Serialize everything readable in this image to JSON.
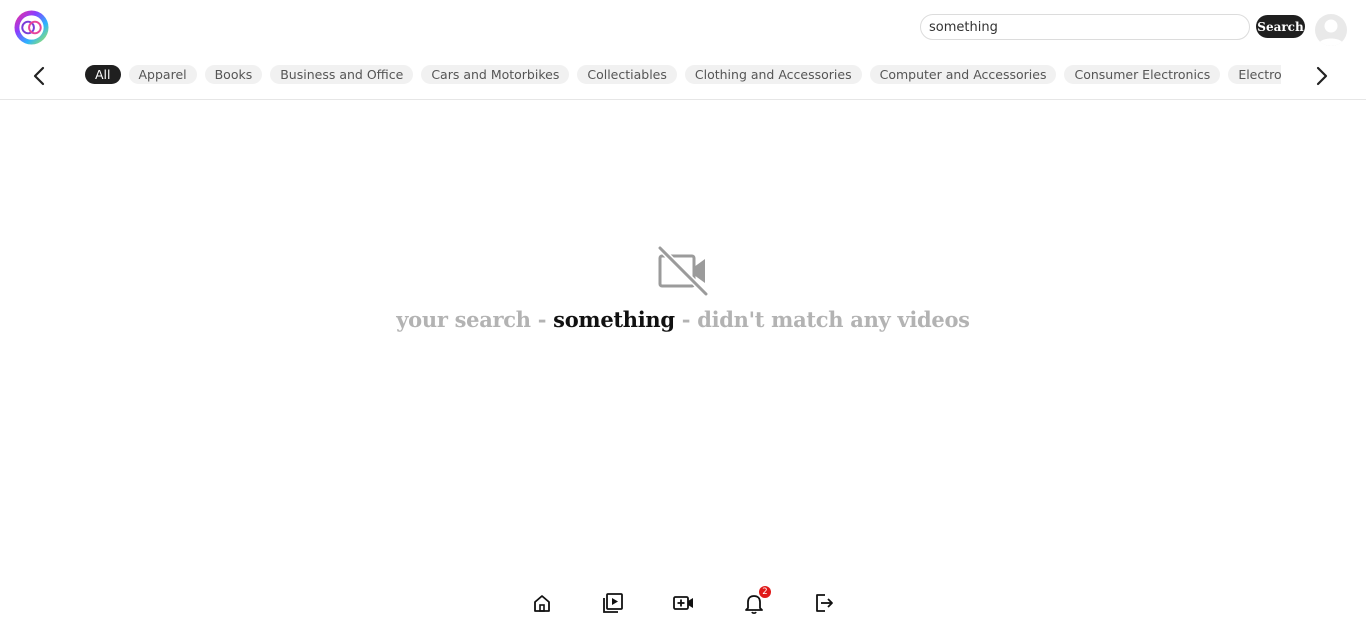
{
  "header": {
    "search": {
      "value": "something",
      "placeholder": ""
    },
    "search_button": "Search"
  },
  "categories": {
    "items": [
      {
        "label": "All",
        "active": true
      },
      {
        "label": "Apparel"
      },
      {
        "label": "Books"
      },
      {
        "label": "Business and Office"
      },
      {
        "label": "Cars and Motorbikes"
      },
      {
        "label": "Collectiables"
      },
      {
        "label": "Clothing and Accessories"
      },
      {
        "label": "Computer and Accessories"
      },
      {
        "label": "Consumer Electronics"
      },
      {
        "label": "Electronics"
      }
    ]
  },
  "empty_state": {
    "icon": "video-off-icon",
    "prefix": "your search - ",
    "term": "something",
    "suffix": " - didn't match any videos"
  },
  "bottom_nav": {
    "items": [
      {
        "name": "home-icon"
      },
      {
        "name": "video-library-icon"
      },
      {
        "name": "add-video-icon"
      },
      {
        "name": "bell-icon",
        "badge": "2"
      },
      {
        "name": "logout-icon"
      }
    ]
  },
  "colors": {
    "accent": "#1f1f1f",
    "badge": "#e01919",
    "muted": "#b3b3b3"
  }
}
